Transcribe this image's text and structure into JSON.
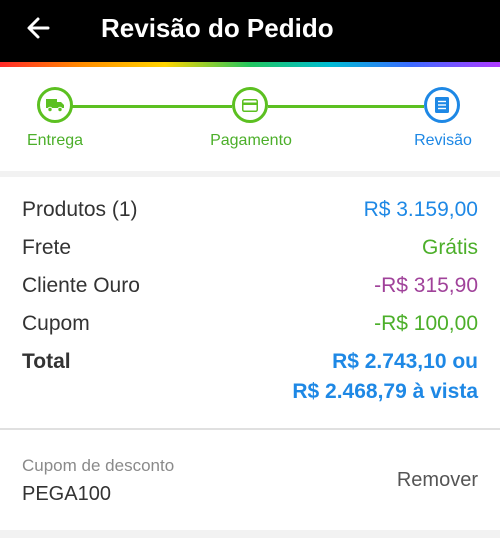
{
  "appbar": {
    "title": "Revisão do Pedido",
    "back_icon": "arrow-left-icon"
  },
  "stepper": {
    "steps": [
      {
        "label": "Entrega",
        "icon": "truck-icon",
        "state": "done"
      },
      {
        "label": "Pagamento",
        "icon": "credit-card-icon",
        "state": "done"
      },
      {
        "label": "Revisão",
        "icon": "document-icon",
        "state": "current"
      }
    ],
    "colors": {
      "done": "#5cc021",
      "current": "#1e88e5"
    }
  },
  "summary": {
    "products_label": "Produtos (1)",
    "products_value": "R$ 3.159,00",
    "shipping_label": "Frete",
    "shipping_value": "Grátis",
    "gold_label": "Cliente Ouro",
    "gold_value": "-R$ 315,90",
    "coupon_label": "Cupom",
    "coupon_value": "-R$ 100,00",
    "total_label": "Total",
    "total_line1": "R$ 2.743,10 ou",
    "total_line2": "R$ 2.468,79 à vista"
  },
  "coupon": {
    "label": "Cupom de desconto",
    "code": "PEGA100",
    "remove_label": "Remover"
  },
  "colors": {
    "appbar": "#000000",
    "blue": "#1e88e5",
    "green": "#4caf2a",
    "purple": "#a0429a"
  }
}
